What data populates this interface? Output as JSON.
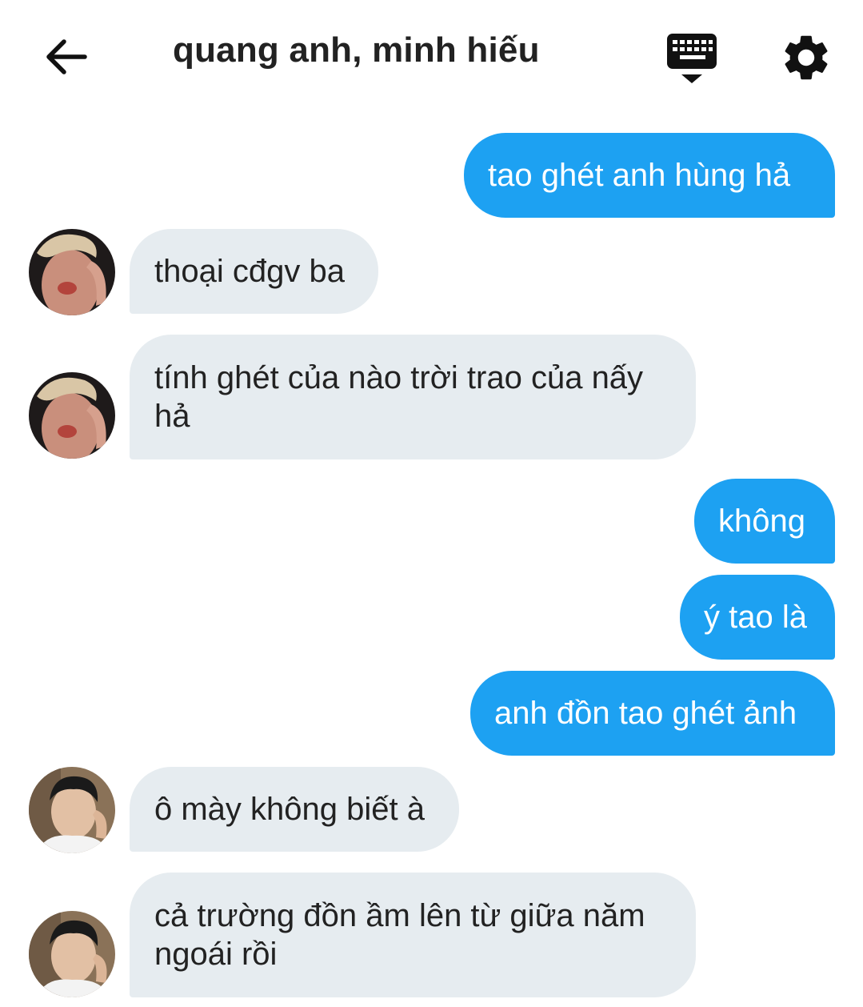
{
  "header": {
    "title": "quang anh, minh hiếu",
    "back_icon": "arrow-left-icon",
    "keyboard_icon": "keyboard-hide-icon",
    "settings_icon": "gear-icon"
  },
  "colors": {
    "sent_bubble": "#1da1f2",
    "received_bubble": "#e6ecf0",
    "text": "#222222"
  },
  "messages": [
    {
      "direction": "sent",
      "text": "tao ghét anh hùng hả"
    },
    {
      "direction": "received",
      "sender_avatar": "avatar-quang-anh",
      "text": "thoại cđgv ba"
    },
    {
      "direction": "received",
      "sender_avatar": "avatar-quang-anh",
      "text": "tính ghét của nào trời trao của nấy hả"
    },
    {
      "direction": "sent",
      "text": "không"
    },
    {
      "direction": "sent",
      "text": "ý tao là"
    },
    {
      "direction": "sent",
      "text": "anh đồn tao ghét ảnh"
    },
    {
      "direction": "received",
      "sender_avatar": "avatar-minh-hieu",
      "text": "ô mày không biết à"
    },
    {
      "direction": "received",
      "sender_avatar": "avatar-minh-hieu",
      "text": "cả trường đồn ầm lên từ giữa năm ngoái rồi"
    }
  ]
}
